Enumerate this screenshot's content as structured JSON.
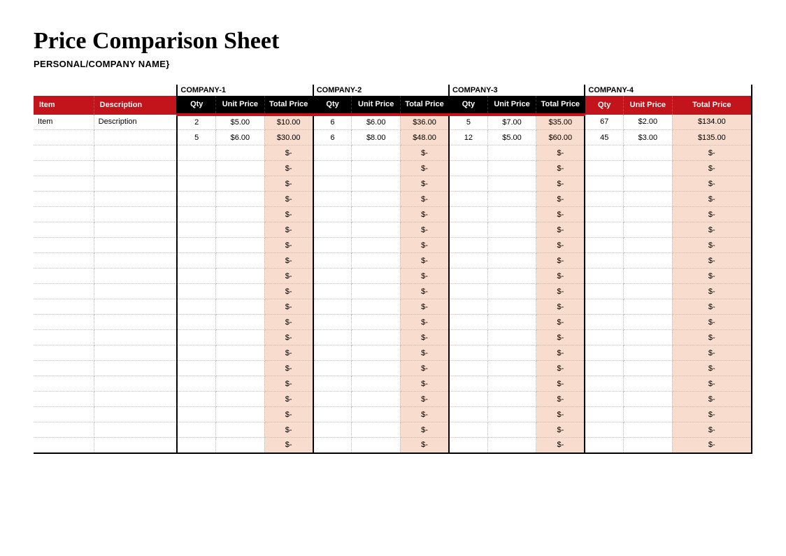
{
  "title": "Price Comparison Sheet",
  "subtitle": "PERSONAL/COMPANY NAME}",
  "headers": {
    "item": "Item",
    "description": "Description",
    "qty": "Qty",
    "unit": "Unit Price",
    "total": "Total Price",
    "totalLong": "Total Price"
  },
  "companies": [
    "COMPANY-1",
    "COMPANY-2",
    "COMPANY-3",
    "COMPANY-4"
  ],
  "empty_placeholder": "$-",
  "rows": [
    {
      "item": "Item",
      "description": "Description",
      "c1": {
        "qty": "2",
        "unit": "$5.00",
        "total": "$10.00"
      },
      "c2": {
        "qty": "6",
        "unit": "$6.00",
        "total": "$36.00"
      },
      "c3": {
        "qty": "5",
        "unit": "$7.00",
        "total": "$35.00"
      },
      "c4": {
        "qty": "67",
        "unit": "$2.00",
        "total": "$134.00"
      }
    },
    {
      "item": "",
      "description": "",
      "c1": {
        "qty": "5",
        "unit": "$6.00",
        "total": "$30.00"
      },
      "c2": {
        "qty": "6",
        "unit": "$8.00",
        "total": "$48.00"
      },
      "c3": {
        "qty": "12",
        "unit": "$5.00",
        "total": "$60.00"
      },
      "c4": {
        "qty": "45",
        "unit": "$3.00",
        "total": "$135.00"
      }
    }
  ],
  "empty_row_count": 20
}
